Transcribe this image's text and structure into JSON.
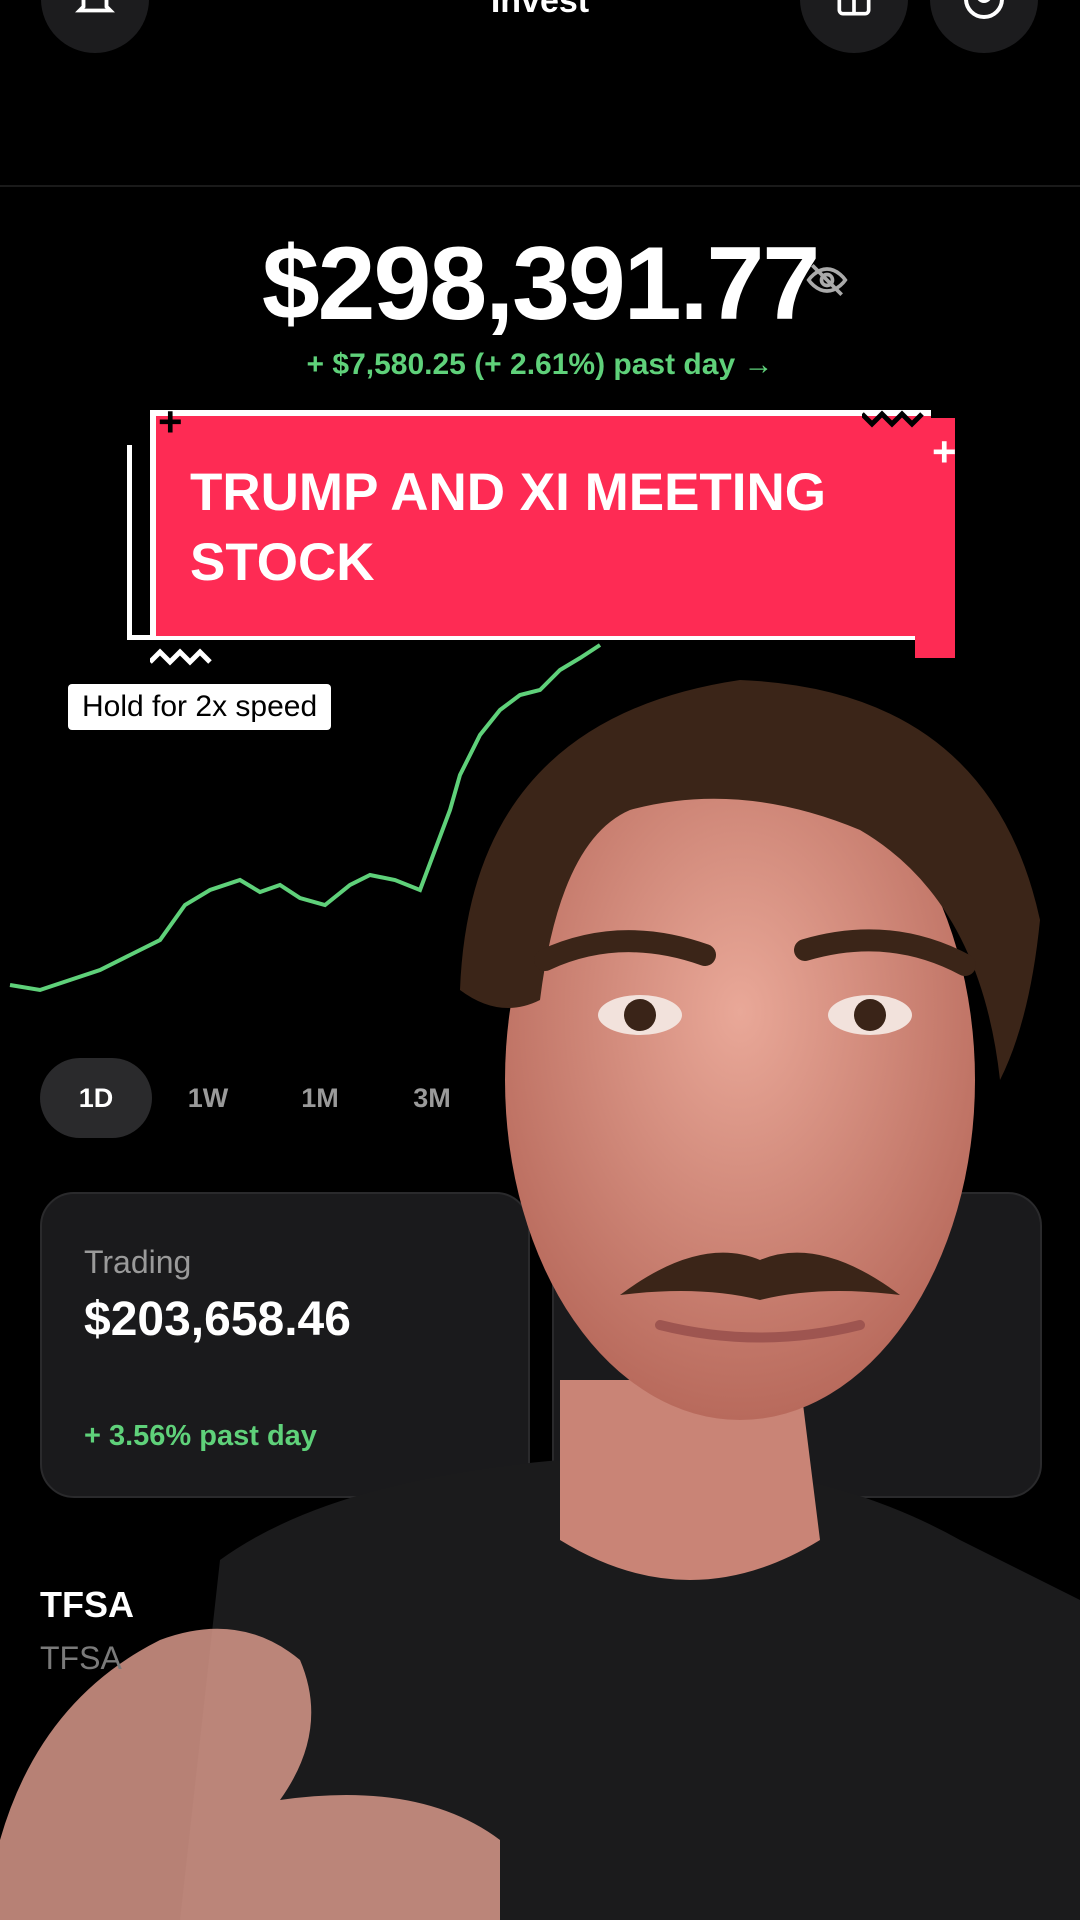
{
  "header": {
    "title": "Invest",
    "icons": [
      "bell-icon",
      "gift-icon",
      "profile-icon"
    ]
  },
  "portfolio": {
    "balance": "$298,391.77",
    "change": "+ $7,580.25 (+ 2.61%) past day →",
    "accent": "#5fd17a"
  },
  "overlay": {
    "headline": "TRUMP AND XI MEETING STOCK",
    "hint": "Hold for 2x speed",
    "sticker_color": "#fe2b54"
  },
  "ranges": [
    "1D",
    "1W",
    "1M",
    "3M"
  ],
  "accounts": [
    {
      "label": "Trading",
      "value": "$203,658.46",
      "change": "+ 3.56% past day"
    }
  ],
  "section": {
    "title": "TFSA",
    "subtitle": "TFSA"
  }
}
